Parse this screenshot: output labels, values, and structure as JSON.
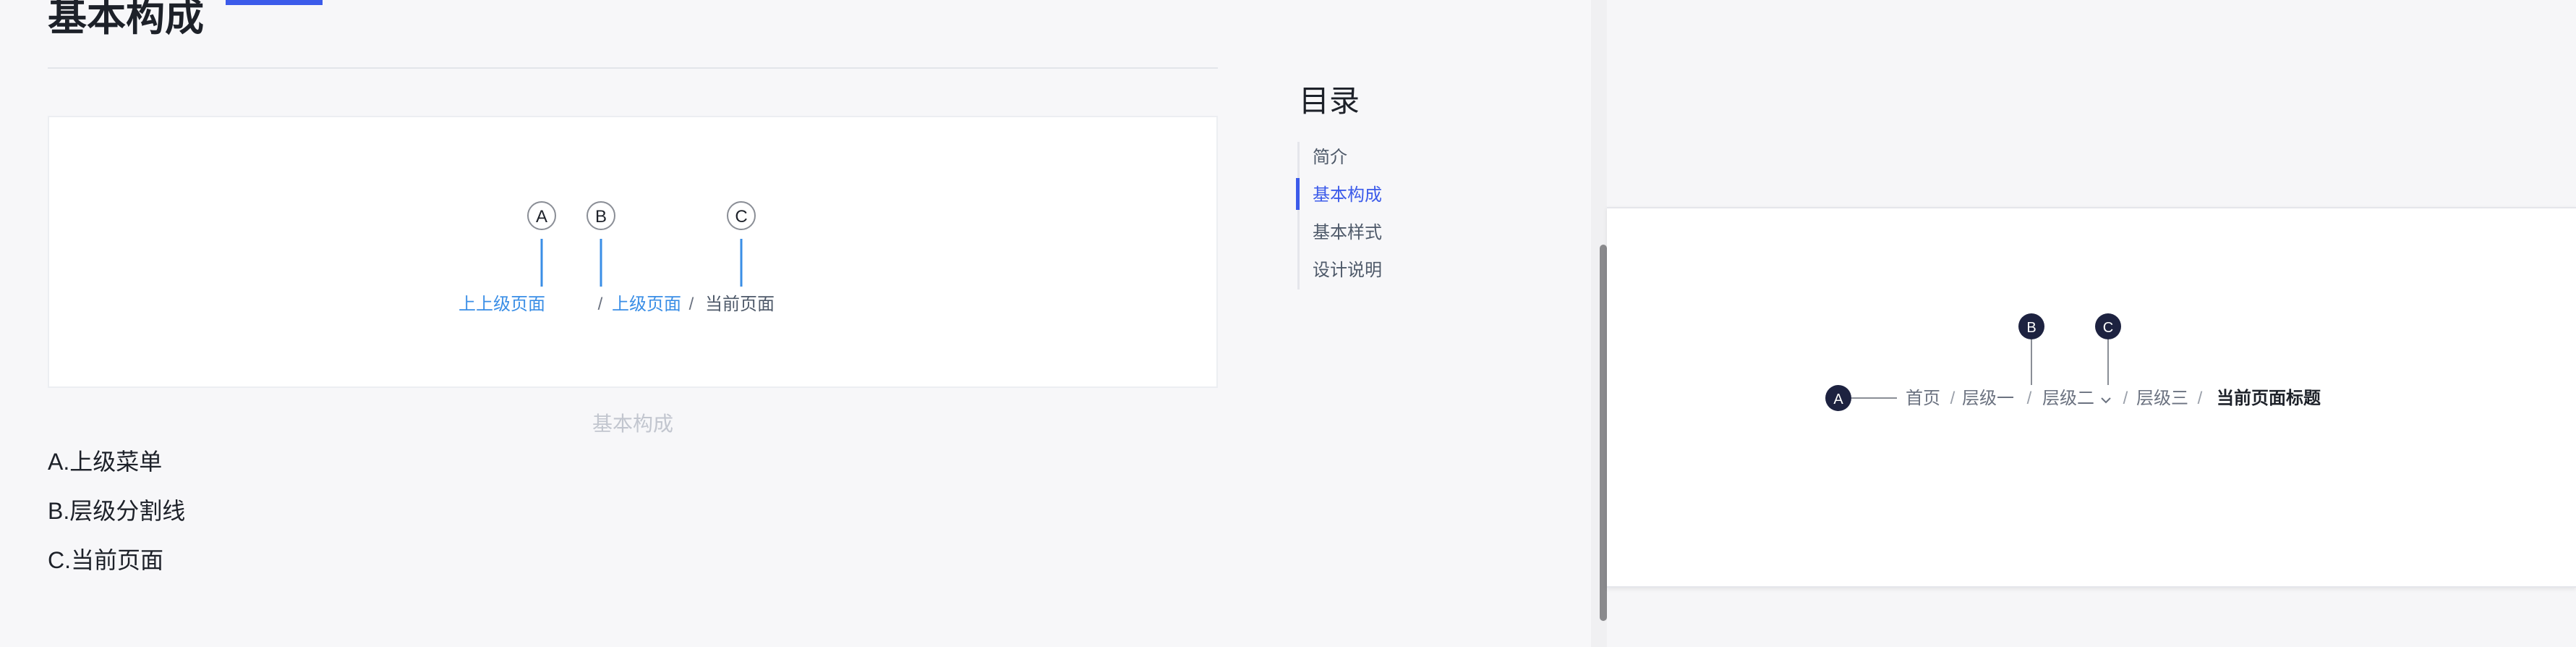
{
  "doc": {
    "title": "基本构成",
    "figure_caption": "基本构成",
    "diagram": {
      "markers": [
        "A",
        "B",
        "C"
      ],
      "crumbs": [
        "上上级页面",
        "上级页面",
        "当前页面"
      ],
      "separator": "/"
    },
    "descriptions": [
      "A.上级菜单",
      "B.层级分割线",
      "C.当前页面"
    ]
  },
  "toc": {
    "title": "目录",
    "items": [
      {
        "label": "简介",
        "active": false
      },
      {
        "label": "基本构成",
        "active": true
      },
      {
        "label": "基本样式",
        "active": false
      },
      {
        "label": "设计说明",
        "active": false
      }
    ]
  },
  "preview": {
    "markers": [
      "A",
      "B",
      "C"
    ],
    "crumbs": [
      "首页",
      "层级一",
      "层级二",
      "层级三",
      "当前页面标题"
    ],
    "separator": "/",
    "dropdown_icon": "chevron-down-icon"
  },
  "colors": {
    "accent": "#3c5bea",
    "link": "#3a8ee6",
    "dark_marker": "#1d2240"
  }
}
